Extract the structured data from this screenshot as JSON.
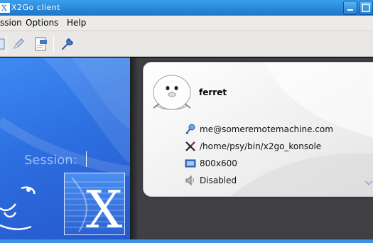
{
  "window": {
    "title": "X2Go client"
  },
  "menu": {
    "items": [
      "ssion",
      "Options",
      "Help"
    ]
  },
  "toolbar": {
    "buttons": [
      "new-session-icon",
      "edit-pencil-icon",
      "export-document-icon",
      "wrench-settings-icon"
    ]
  },
  "login": {
    "session_label": "Session:",
    "session_value": ""
  },
  "session_card": {
    "name": "ferret",
    "server": "me@someremotemachine.com",
    "command": "/home/psy/bin/x2go_konsole",
    "resolution": "800x600",
    "sound": "Disabled"
  },
  "colors": {
    "accent_blue": "#2d6fe0",
    "titlebar": "#1f74c8",
    "background": "#3f3f44"
  }
}
